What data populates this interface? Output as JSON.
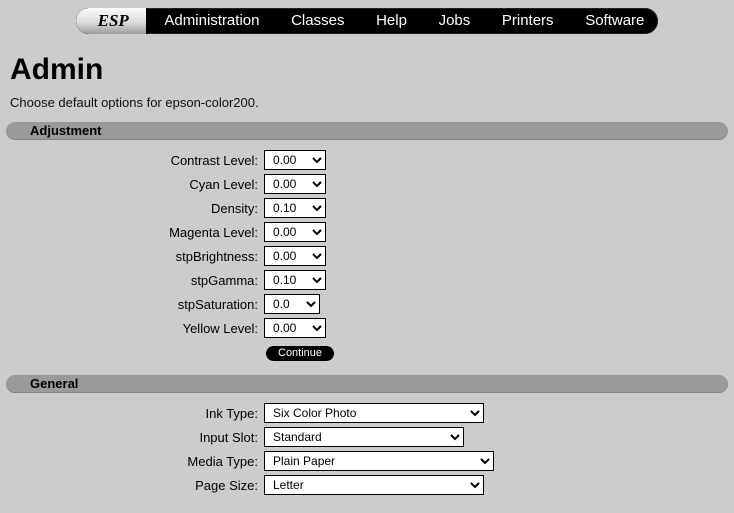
{
  "nav": {
    "brand": "ESP",
    "items": [
      "Administration",
      "Classes",
      "Help",
      "Jobs",
      "Printers",
      "Software"
    ]
  },
  "page": {
    "title": "Admin",
    "intro": "Choose default options for epson-color200."
  },
  "sections": {
    "adjustment": {
      "title": "Adjustment"
    },
    "general": {
      "title": "General"
    }
  },
  "adjustment": {
    "contrast_level": {
      "label": "Contrast Level:",
      "value": "0.00"
    },
    "cyan_level": {
      "label": "Cyan Level:",
      "value": "0.00"
    },
    "density": {
      "label": "Density:",
      "value": "0.10"
    },
    "magenta_level": {
      "label": "Magenta Level:",
      "value": "0.00"
    },
    "stp_brightness": {
      "label": "stpBrightness:",
      "value": "0.00"
    },
    "stp_gamma": {
      "label": "stpGamma:",
      "value": "0.10"
    },
    "stp_saturation": {
      "label": "stpSaturation:",
      "value": "0.0"
    },
    "yellow_level": {
      "label": "Yellow Level:",
      "value": "0.00"
    }
  },
  "buttons": {
    "continue": "Continue"
  },
  "general": {
    "ink_type": {
      "label": "Ink Type:",
      "value": "Six Color Photo"
    },
    "input_slot": {
      "label": "Input Slot:",
      "value": "Standard"
    },
    "media_type": {
      "label": "Media Type:",
      "value": "Plain Paper"
    },
    "page_size": {
      "label": "Page Size:",
      "value": "Letter"
    }
  }
}
